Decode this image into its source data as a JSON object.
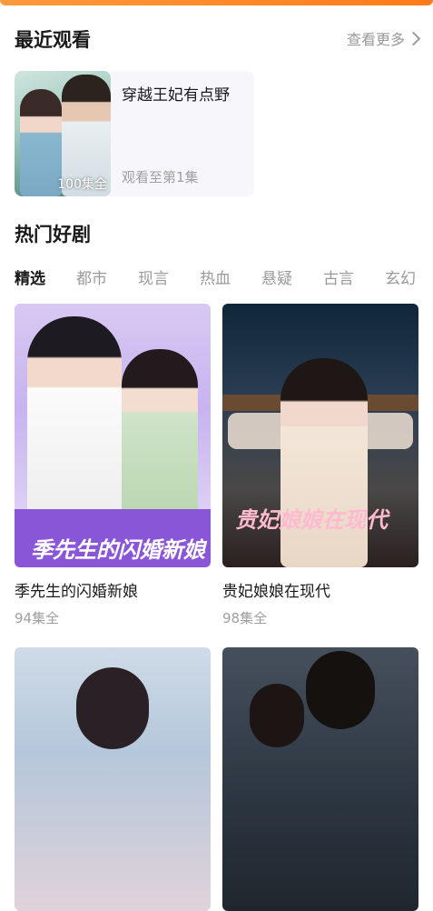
{
  "recent": {
    "section_title": "最近观看",
    "more_label": "查看更多",
    "item": {
      "title": "穿越王妃有点野",
      "episodes_badge": "100集全",
      "progress": "观看至第1集"
    }
  },
  "hot": {
    "section_title": "热门好剧",
    "tabs": [
      "精选",
      "都市",
      "现言",
      "热血",
      "悬疑",
      "古言",
      "玄幻"
    ],
    "active_tab": "精选",
    "cards": [
      {
        "title": "季先生的闪婚新娘",
        "episodes": "94集全",
        "poster_text": "季先生的闪婚新娘"
      },
      {
        "title": "贵妃娘娘在现代",
        "episodes": "98集全",
        "poster_text": "贵妃娘娘在现代"
      },
      {
        "title": "",
        "episodes": "",
        "poster_text": ""
      },
      {
        "title": "",
        "episodes": "",
        "poster_text": ""
      }
    ]
  },
  "colors": {
    "accent_orange": "#ff8a2a",
    "text_primary": "#1a1a1a",
    "text_secondary": "#9a9a9a",
    "card_bg": "#f6f6fb"
  }
}
